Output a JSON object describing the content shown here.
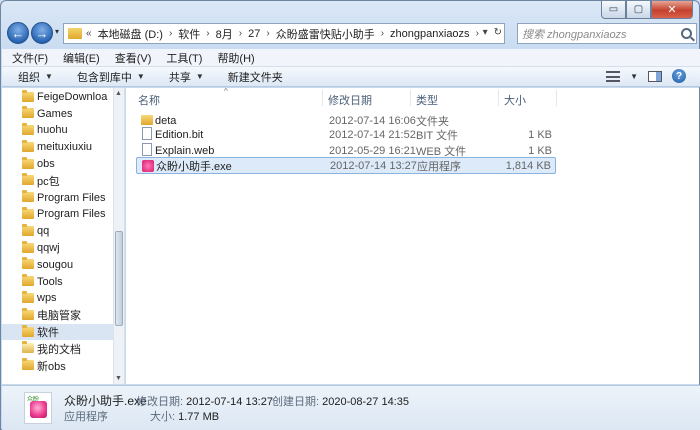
{
  "window": {
    "caption_buttons": {
      "minimize": "▭",
      "maximize": "▢",
      "close": "✕"
    }
  },
  "address": {
    "prefix": "«",
    "crumbs": [
      "本地磁盘 (D:)",
      "软件",
      "8月",
      "27",
      "众盼盛雷快贴小助手",
      "zhongpanxiaozs"
    ],
    "separator": "›",
    "dropdown_glyph": "▾",
    "refresh_glyph": "↻"
  },
  "search": {
    "placeholder": "搜索 zhongpanxiaozs"
  },
  "menubar": {
    "items": [
      "文件(F)",
      "编辑(E)",
      "查看(V)",
      "工具(T)",
      "帮助(H)"
    ]
  },
  "commandbar": {
    "organize": "组织",
    "include": "包含到库中",
    "share": "共享",
    "new_folder": "新建文件夹",
    "arrow": "▼",
    "help_glyph": "?"
  },
  "nav": {
    "items": [
      {
        "label": "FeigeDownloa"
      },
      {
        "label": "Games"
      },
      {
        "label": "huohu"
      },
      {
        "label": "meituxiuxiu"
      },
      {
        "label": "obs"
      },
      {
        "label": "pc包"
      },
      {
        "label": "Program Files"
      },
      {
        "label": "Program Files"
      },
      {
        "label": "qq"
      },
      {
        "label": "qqwj"
      },
      {
        "label": "sougou"
      },
      {
        "label": "Tools"
      },
      {
        "label": "wps"
      },
      {
        "label": "电脑管家"
      },
      {
        "label": "软件",
        "selected": true
      },
      {
        "label": "我的文档"
      },
      {
        "label": "新obs"
      }
    ],
    "scroll_up": "▲",
    "scroll_down": "▼"
  },
  "filelist": {
    "columns": {
      "name": "名称",
      "modified": "修改日期",
      "type": "类型",
      "size": "大小"
    },
    "sort_glyph": "^",
    "rows": [
      {
        "name": "deta",
        "modified": "2012-07-14 16:06",
        "type": "文件夹",
        "size": "",
        "icon": "folder-icon"
      },
      {
        "name": "Edition.bit",
        "modified": "2012-07-14 21:52",
        "type": "BIT 文件",
        "size": "1 KB",
        "icon": "file-icon"
      },
      {
        "name": "Explain.web",
        "modified": "2012-05-29 16:21",
        "type": "WEB 文件",
        "size": "1 KB",
        "icon": "file-icon"
      },
      {
        "name": "众盼小助手.exe",
        "modified": "2012-07-14 13:27",
        "type": "应用程序",
        "size": "1,814 KB",
        "icon": "exe-icon",
        "selected": true
      }
    ]
  },
  "details": {
    "icon_badge": "众盼",
    "name": "众盼小助手.exe",
    "modified_label": "修改日期:",
    "modified": "2012-07-14 13:27",
    "created_label": "创建日期:",
    "created": "2020-08-27 14:35",
    "type": "应用程序",
    "size_label": "大小:",
    "size": "1.77 MB"
  }
}
